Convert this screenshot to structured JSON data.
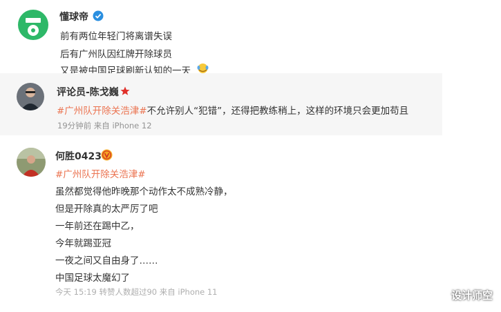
{
  "post1": {
    "author": "懂球帝",
    "avatar_text": "懂球帝",
    "lines": [
      "前有两位年轻门将离谱失误",
      "后有广州队因红牌开除球员",
      "又是被中国足球刷新认知的一天"
    ],
    "verified_icon": "blue-verified-check-icon",
    "emoji": "crying-laughing-emoji-icon"
  },
  "post2": {
    "author": "评论员-陈戈巍",
    "badge_icon": "red-star-icon",
    "hashtag": "#广州队开除关浩津#",
    "text": "不允许别人“犯错”，还得把教练稍上，这样的环境只会更加苟且",
    "meta": "19分钟前  来自 iPhone 12"
  },
  "post3": {
    "author": "何胜0423",
    "badge_icon": "orange-verified-v-icon",
    "hashtag": "#广州队开除关浩津#",
    "lines": [
      "虽然都觉得他昨晚那个动作太不成熟冷静，",
      "但是开除真的太严厉了吧",
      "一年前还在踢中乙，",
      "今年就踢亚冠",
      "一夜之间又自由身了……",
      "中国足球太魔幻了"
    ],
    "meta": "今天 15:19 转赞人数超过90  来自 iPhone 11"
  },
  "watermark": "设计师空",
  "colors": {
    "accent": "#eb7350",
    "brand_green": "#2eb868",
    "verified_blue": "#2a8fe0",
    "muted": "#939393"
  }
}
